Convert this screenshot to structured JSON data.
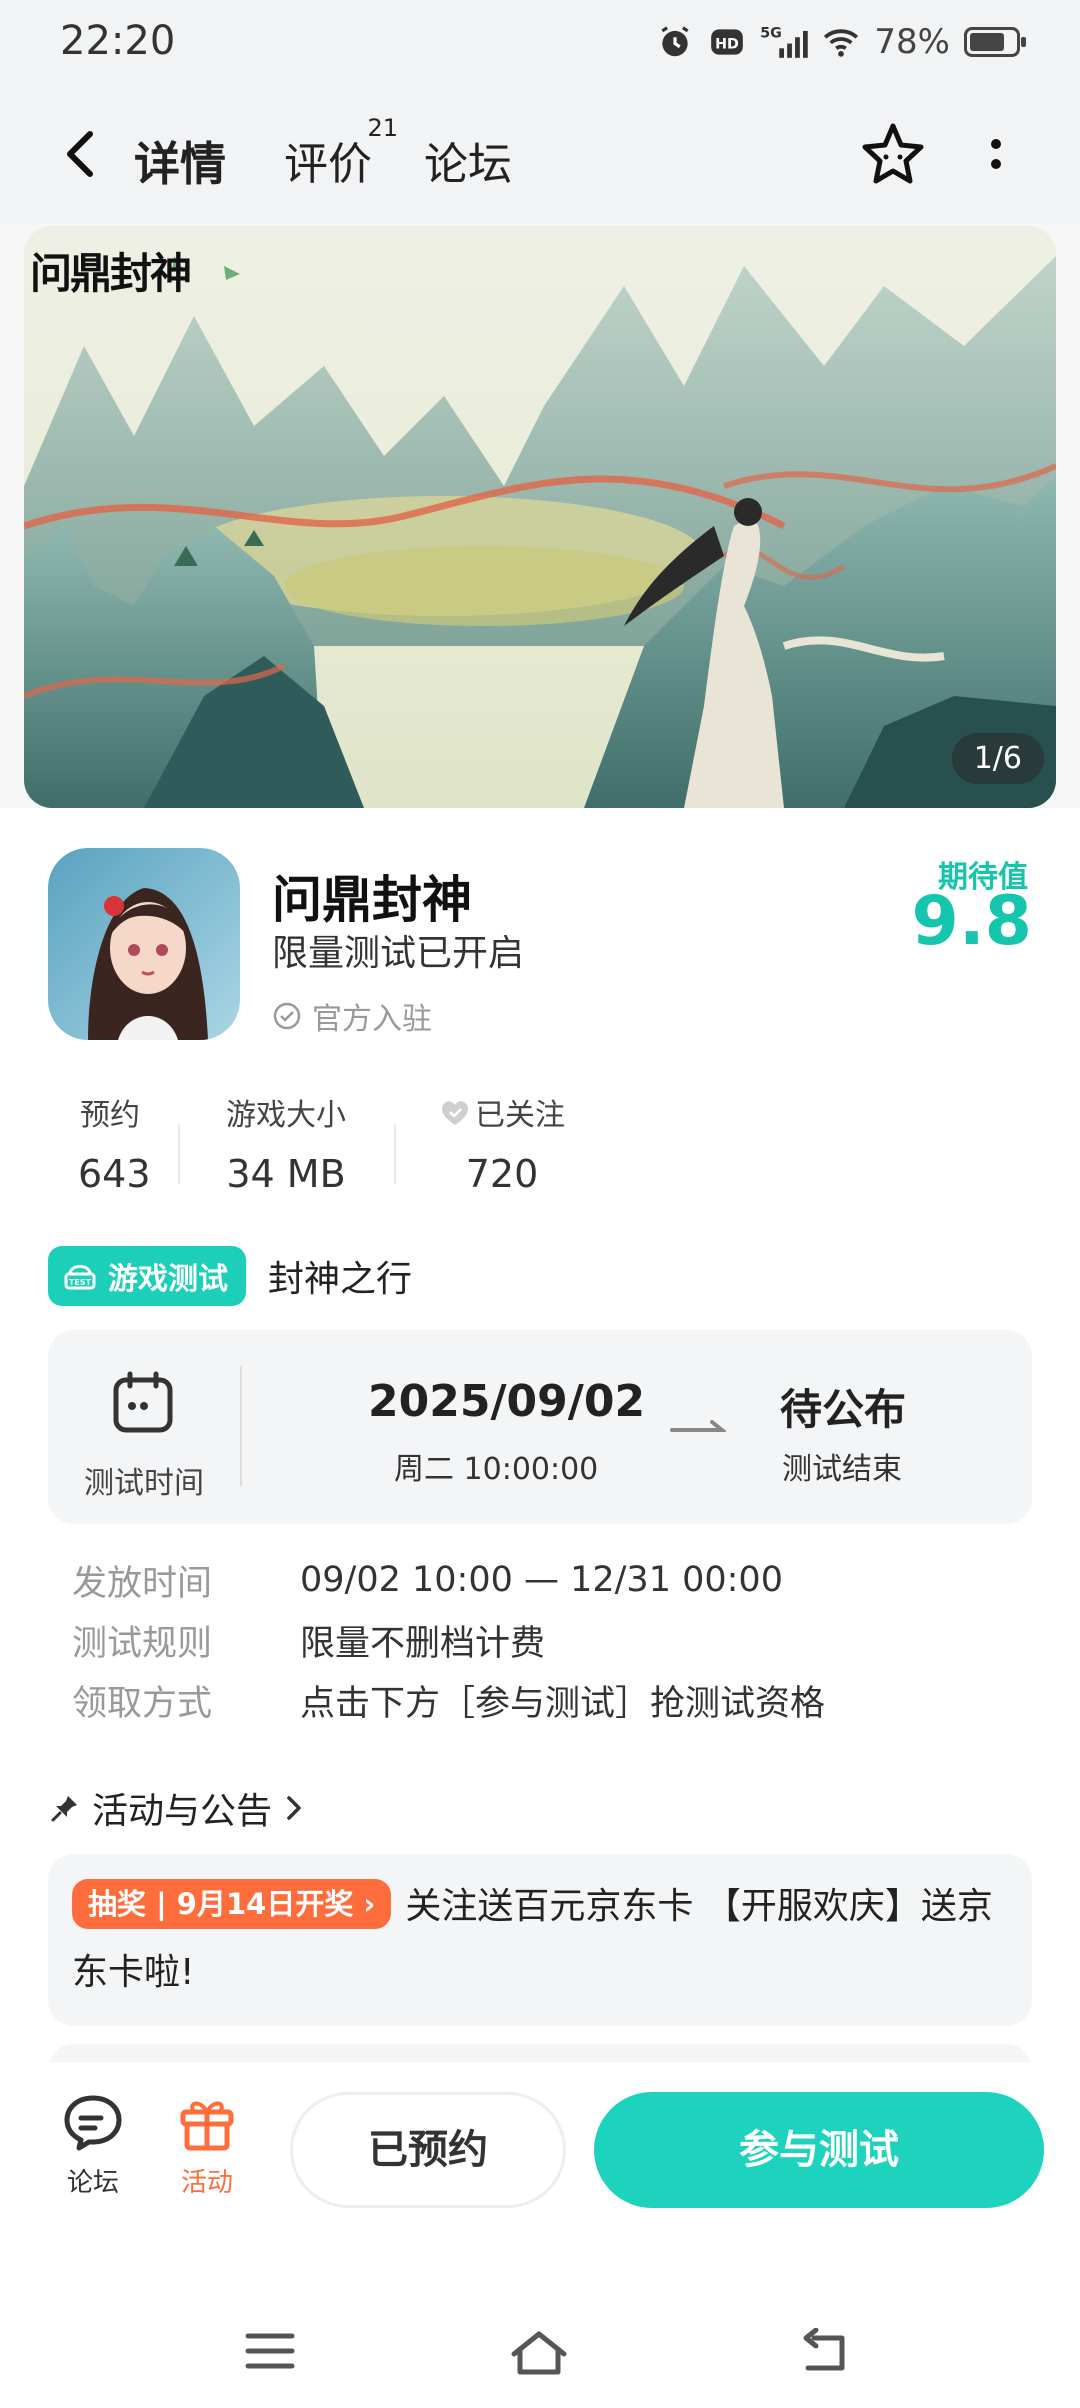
{
  "status_bar": {
    "time": "22:20",
    "battery": "78%",
    "network": "5G"
  },
  "nav": {
    "tabs": [
      {
        "label": "详情"
      },
      {
        "label": "评价",
        "badge": "21"
      },
      {
        "label": "论坛"
      }
    ]
  },
  "banner": {
    "logo_text": "问鼎封神",
    "counter": "1/6"
  },
  "game": {
    "title": "问鼎封神",
    "subtitle": "限量测试已开启",
    "official": "官方入驻",
    "expect_label": "期待值",
    "expect_value": "9.8"
  },
  "stats": [
    {
      "label": "预约",
      "value": "643"
    },
    {
      "label": "游戏大小",
      "value": "34 MB"
    },
    {
      "label": "已关注",
      "value": "720"
    }
  ],
  "test": {
    "tag": "游戏测试",
    "name": "封神之行",
    "time_label": "测试时间",
    "start_date": "2025/09/02",
    "start_day": "周二  10:00:00",
    "end_value": "待公布",
    "end_label": "测试结束"
  },
  "rules": [
    {
      "label": "发放时间",
      "value": "09/02 10:00 — 12/31 00:00"
    },
    {
      "label": "测试规则",
      "value": "限量不删档计费"
    },
    {
      "label": "领取方式",
      "value": "点击下方［参与测试］抢测试资格"
    }
  ],
  "activities": {
    "heading": "活动与公告",
    "items": [
      {
        "tag": "抽奖 | 9月14日开奖 ›",
        "text": "关注送百元京东卡 【开服欢庆】送京东卡啦!"
      }
    ]
  },
  "action_bar": {
    "forum_label": "论坛",
    "activity_label": "活动",
    "reserved_label": "已预约",
    "join_label": "参与测试"
  },
  "colors": {
    "accent": "#1ed3be",
    "lottery": "#ff6d3d",
    "expect": "#16c5ad"
  }
}
